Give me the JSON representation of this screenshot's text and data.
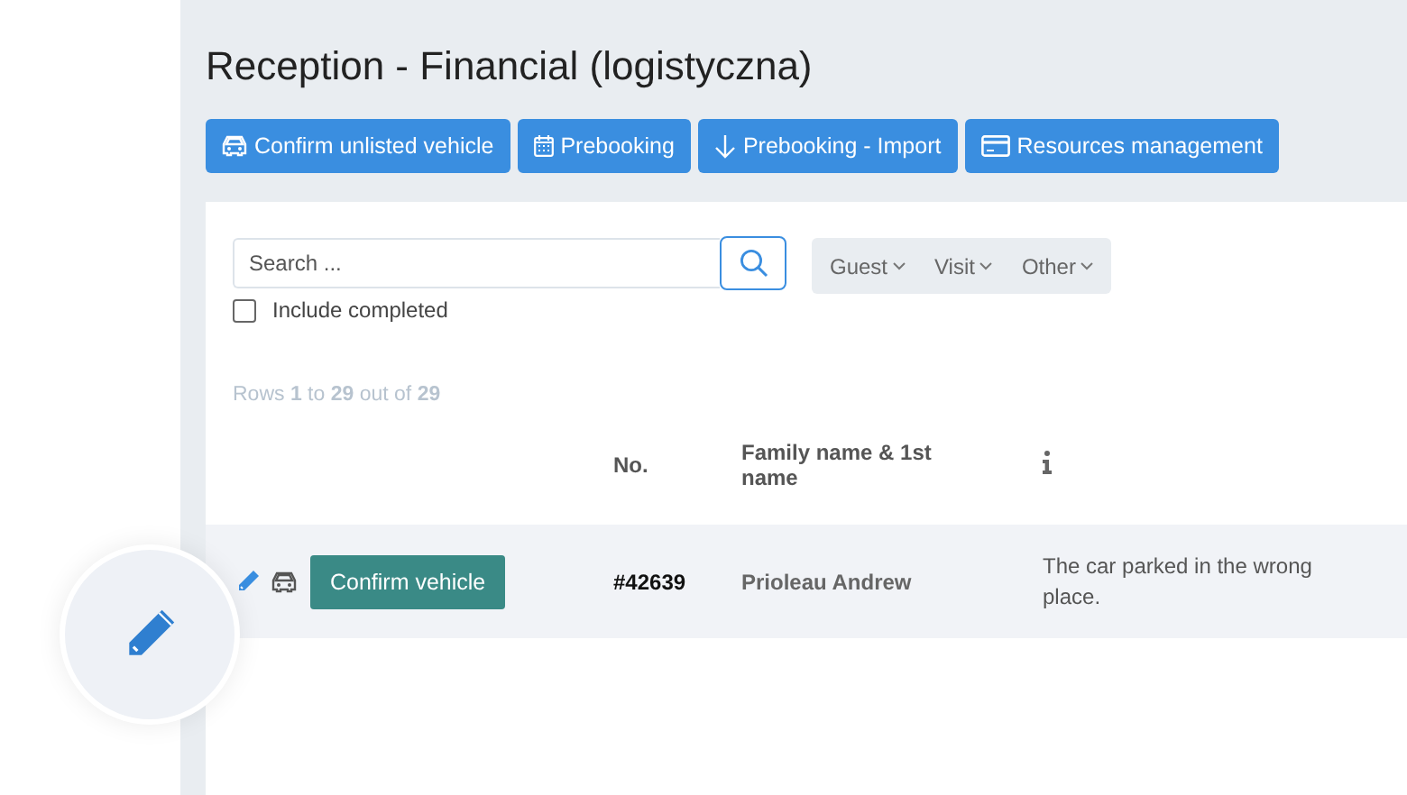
{
  "page": {
    "title": "Reception - Financial (logistyczna)"
  },
  "actions": [
    {
      "label": "Confirm unlisted vehicle",
      "kind": "car"
    },
    {
      "label": "Prebooking",
      "kind": "calendar"
    },
    {
      "label": "Prebooking - Import",
      "kind": "download"
    },
    {
      "label": "Resources management",
      "kind": "card"
    }
  ],
  "search": {
    "placeholder": "Search ..."
  },
  "filters": [
    "Guest",
    "Visit",
    "Other"
  ],
  "include_completed": {
    "label": "Include completed",
    "checked": false
  },
  "rows_info": "Rows **1** to **29** out of **29**",
  "table": {
    "columns": [
      "No.",
      "Family name & 1st name"
    ],
    "rows": [
      {
        "action": "Confirm vehicle",
        "no": "#42639",
        "name": "Prioleau Andrew",
        "note": "The car parked in the wrong place."
      }
    ]
  }
}
